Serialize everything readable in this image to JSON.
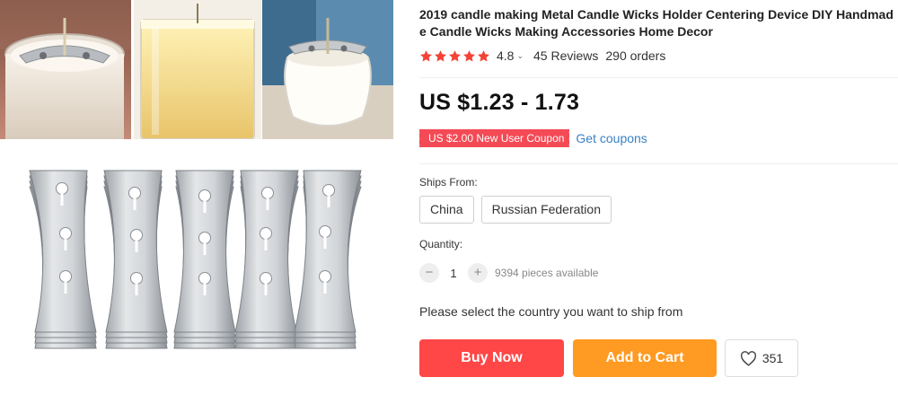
{
  "product": {
    "title": "2019 candle making Metal Candle Wicks Holder Centering Device DIY Handmade Candle Wicks Making Accessories Home Decor",
    "rating": "4.8",
    "reviews": "45 Reviews",
    "orders": "290 orders",
    "price": "US $1.23 - 1.73",
    "coupon": "US $2.00 New User Coupon",
    "get_coupons": "Get coupons"
  },
  "shipping": {
    "label": "Ships From:",
    "options": [
      "China",
      "Russian Federation"
    ]
  },
  "quantity": {
    "label": "Quantity:",
    "value": "1",
    "available": "9394 pieces available",
    "minus": "−",
    "plus": "+"
  },
  "notice": "Please select the country you want to ship from",
  "actions": {
    "buy_now": "Buy Now",
    "add_to_cart": "Add to Cart",
    "wishlist_count": "351"
  },
  "colors": {
    "star": "#f44336",
    "buy_now": "#ff4747",
    "add_to_cart": "#ff9a22",
    "coupon": "#f34a55",
    "link": "#3b82c4"
  },
  "icons": {
    "rating": "star-icon",
    "rating_dropdown": "chevron-down-icon",
    "wishlist": "heart-icon"
  }
}
